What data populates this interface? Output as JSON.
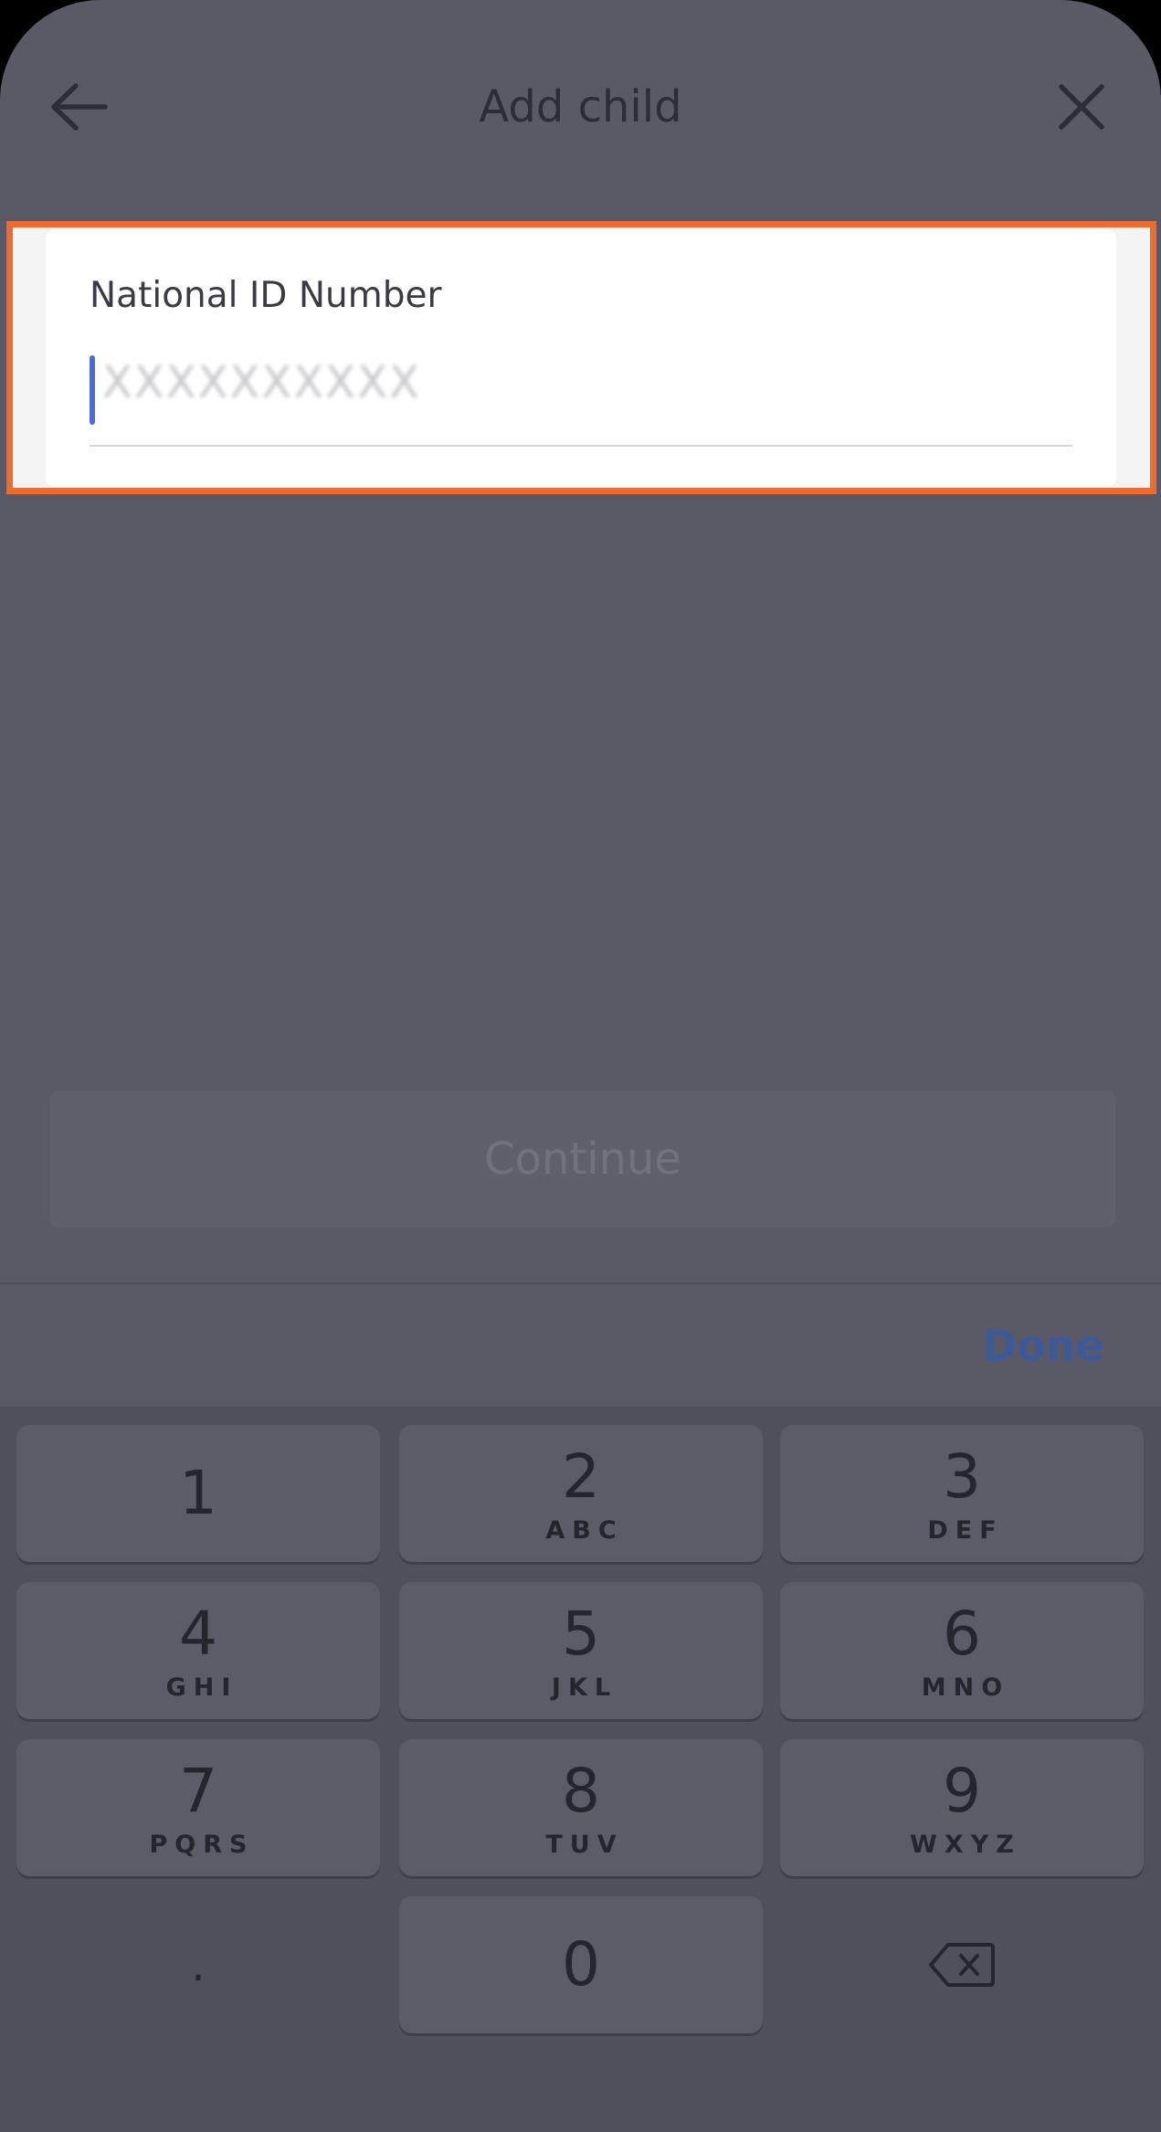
{
  "header": {
    "title": "Add child",
    "back_icon": "arrow-left-icon",
    "close_icon": "close-icon"
  },
  "form": {
    "field_label": "National ID Number",
    "field_value": "",
    "field_placeholder": "XXXXXXXXXX"
  },
  "actions": {
    "continue_label": "Continue"
  },
  "keyboard_toolbar": {
    "done_label": "Done"
  },
  "keypad": {
    "keys": [
      {
        "digit": "1",
        "letters": ""
      },
      {
        "digit": "2",
        "letters": "ABC"
      },
      {
        "digit": "3",
        "letters": "DEF"
      },
      {
        "digit": "4",
        "letters": "GHI"
      },
      {
        "digit": "5",
        "letters": "JKL"
      },
      {
        "digit": "6",
        "letters": "MNO"
      },
      {
        "digit": "7",
        "letters": "PQRS"
      },
      {
        "digit": "8",
        "letters": "TUV"
      },
      {
        "digit": "9",
        "letters": "WXYZ"
      },
      {
        "digit": "0",
        "letters": ""
      }
    ],
    "decimal_key": ".",
    "delete_icon": "backspace-icon"
  },
  "colors": {
    "highlight": "#ee6a2d",
    "caret": "#4a6bd8",
    "done": "#3c5a98"
  }
}
